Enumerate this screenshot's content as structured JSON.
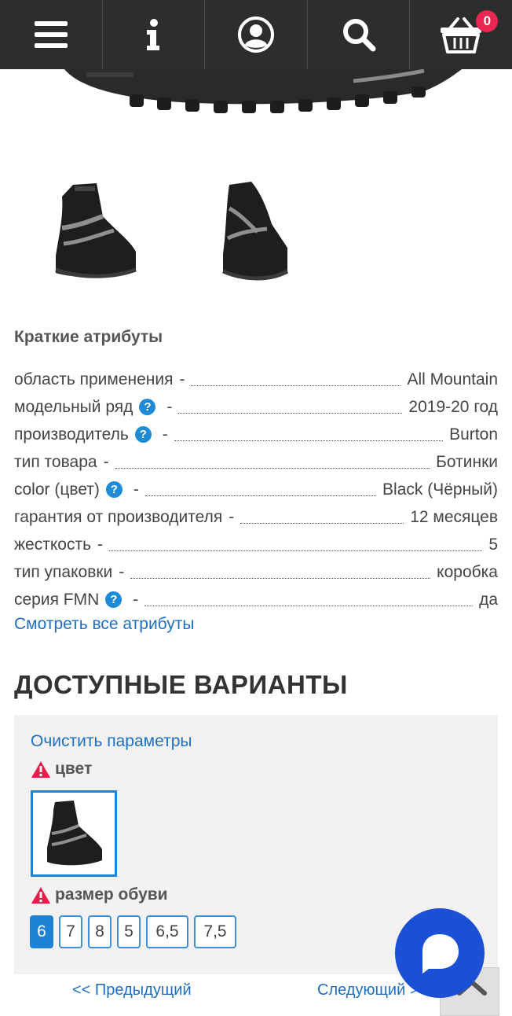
{
  "header": {
    "cart_count": "0"
  },
  "attributes": {
    "title": "Краткие атрибуты",
    "rows": [
      {
        "label": "область применения",
        "value": "All Mountain"
      },
      {
        "label": "модельный ряд",
        "value": "2019-20 год"
      },
      {
        "label": "производитель",
        "value": "Burton"
      },
      {
        "label": "тип товара",
        "value": "Ботинки"
      },
      {
        "label": "color (цвет)",
        "value": "Black (Чёрный)"
      },
      {
        "label": "гарантия от производителя",
        "value": "12 месяцев"
      },
      {
        "label": "жесткость",
        "value": "5"
      },
      {
        "label": "тип упаковки",
        "value": "коробка"
      },
      {
        "label": "серия FMN",
        "value": "да"
      }
    ],
    "dash": "-",
    "help_glyph": "?",
    "view_all": "Смотреть все атрибуты"
  },
  "variants": {
    "title": "ДОСТУПНЫЕ ВАРИАНТЫ",
    "clear": "Очистить параметры",
    "color_label": "цвет",
    "size_label": "размер обуви",
    "sizes": [
      "6",
      "7",
      "8",
      "5",
      "6,5",
      "7,5"
    ],
    "selected_size": "6"
  },
  "pager": {
    "prev": "<< Предыдущий",
    "next": "Следующий >"
  },
  "colors": {
    "nav_bg": "#2d2d2d",
    "accent": "#1e82d6",
    "link": "#1e6fc2",
    "badge": "#e8264f",
    "chat": "#1a4fd6"
  }
}
